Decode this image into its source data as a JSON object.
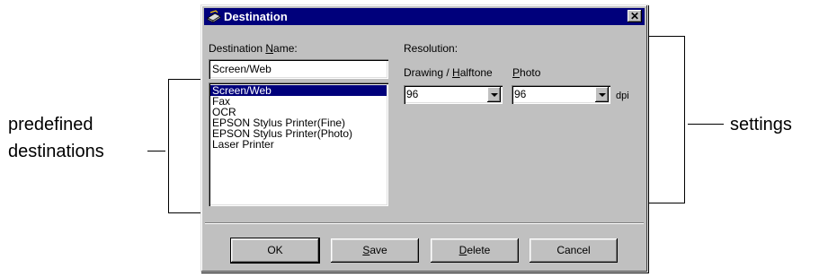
{
  "window": {
    "title": "Destination",
    "close_label": "✕"
  },
  "name_section": {
    "label_pre": "Destination ",
    "label_key": "N",
    "label_post": "ame:",
    "value": "Screen/Web",
    "list": [
      "Screen/Web",
      "Fax",
      "OCR",
      "EPSON Stylus Printer(Fine)",
      "EPSON Stylus Printer(Photo)",
      "Laser Printer"
    ],
    "selected": "Screen/Web"
  },
  "resolution": {
    "label": "Resolution:",
    "drawing_label_pre": "Drawing / ",
    "drawing_label_key": "H",
    "drawing_label_post": "alftone",
    "photo_label_key": "P",
    "photo_label_post": "hoto",
    "drawing_value": "96",
    "photo_value": "96",
    "unit": "dpi"
  },
  "buttons": {
    "ok": "OK",
    "save_key": "S",
    "save_post": "ave",
    "delete_key": "D",
    "delete_post": "elete",
    "cancel": "Cancel"
  },
  "annotations": {
    "left_line1": "predefined",
    "left_line2": "destinations",
    "right": "settings"
  },
  "colors": {
    "titlebar": "#00007b",
    "dialog_face": "#c0c0c0",
    "selection": "#00007b"
  }
}
